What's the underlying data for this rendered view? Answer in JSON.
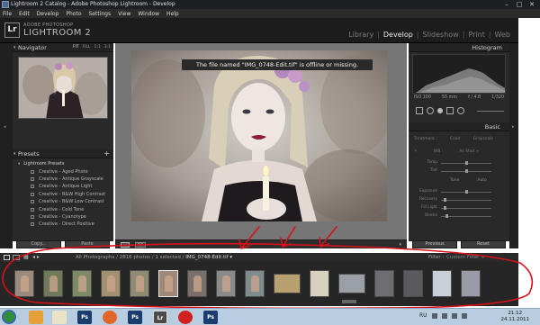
{
  "window": {
    "title": "Lightroom 2 Catalog - Adobe Photoshop Lightroom - Develop"
  },
  "menu": [
    "File",
    "Edit",
    "Develop",
    "Photo",
    "Settings",
    "View",
    "Window",
    "Help"
  ],
  "identity": {
    "logo": "Lr",
    "adobe": "ADOBE PHOTOSHOP",
    "product": "LIGHTROOM 2"
  },
  "modules": {
    "library": "Library",
    "develop": "Develop",
    "slideshow": "Slideshow",
    "print": "Print",
    "web": "Web",
    "active": "Develop"
  },
  "left_panel": {
    "navigator_title": "Navigator",
    "zoom_options": [
      "FIT",
      "FILL",
      "1:1",
      "3:1"
    ],
    "presets_title": "Presets",
    "presets_folder": "Lightroom Presets",
    "presets": [
      "Creative - Aged Photo",
      "Creative - Antique Grayscale",
      "Creative - Antique Light",
      "Creative - B&W High Contrast",
      "Creative - B&W Low Contrast",
      "Creative - Cold Tone",
      "Creative - Cyanotype",
      "Creative - Direct Positive"
    ],
    "copy_button": "Copy...",
    "paste_button": "Paste"
  },
  "center": {
    "offline_message": "The file named \"IMG_0748-Edit.tif\" is offline or missing."
  },
  "right_panel": {
    "histogram_title": "Histogram",
    "hist_info": {
      "iso": "ISO 100",
      "focal": "55 mm",
      "aperture": "f / 4.8",
      "shutter": "1/320"
    },
    "basic_title": "Basic",
    "treatment": {
      "label": "Treatment :",
      "color": "Color",
      "grayscale": "Grayscale"
    },
    "wb": {
      "label": "WB :",
      "value": "As Shot ÷"
    },
    "sliders_wb": [
      {
        "name": "Temp",
        "value": "",
        "knob": 0.5
      },
      {
        "name": "Tint",
        "value": "",
        "knob": 0.5
      }
    ],
    "tone": {
      "label": "Tone",
      "auto": "Auto"
    },
    "sliders_tone": [
      {
        "name": "Exposure",
        "value": "",
        "knob": 0.5
      },
      {
        "name": "Recovery",
        "value": "",
        "knob": 0.08
      },
      {
        "name": "Fill Light",
        "value": "",
        "knob": 0.08
      },
      {
        "name": "Blacks",
        "value": "",
        "knob": 0.12
      }
    ],
    "previous_button": "Previous",
    "reset_button": "Reset"
  },
  "filmstrip": {
    "breadcrumb_prefix": "All Photographs / 2816 photos / 1 selected /",
    "breadcrumb_file": "IMG_0748-Edit.tif ▾",
    "filter_label": "Filter :",
    "filter_value": "Custom Filter ÷"
  },
  "taskbar": {
    "apps": [
      "Ps",
      "Ps",
      "Lr",
      "Ps"
    ],
    "language": "RU",
    "time": "21:12",
    "date": "24.11.2011"
  },
  "colors": {
    "annotation": "#d8121b",
    "app_bg": "#292929",
    "taskbar": "#b9cde0"
  }
}
